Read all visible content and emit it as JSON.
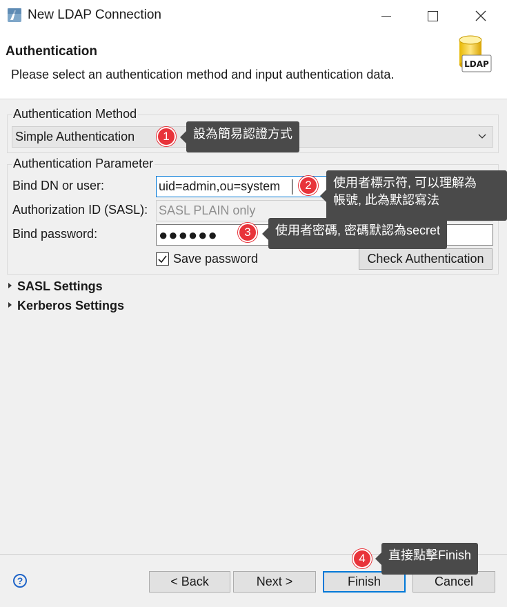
{
  "window": {
    "title": "New LDAP Connection",
    "minimize": "—",
    "maximize": "☐",
    "close": "✕"
  },
  "header": {
    "title": "Authentication",
    "description": "Please select an authentication method and input authentication data.",
    "logo_text": "LDAP"
  },
  "auth_method": {
    "group_label": "Authentication Method",
    "selected": "Simple Authentication"
  },
  "auth_param": {
    "group_label": "Authentication Parameter",
    "bind_dn_label": "Bind DN or user:",
    "bind_dn_value": "uid=admin,ou=system",
    "authz_label": "Authorization ID (SASL):",
    "authz_placeholder": "SASL PLAIN only",
    "password_label": "Bind password:",
    "password_value": "●●●●●●",
    "save_password_label": "Save password",
    "save_password_checked": true,
    "check_auth_label": "Check Authentication"
  },
  "sections": {
    "sasl": "SASL Settings",
    "kerberos": "Kerberos Settings"
  },
  "footer": {
    "help": "?",
    "back": "< Back",
    "next": "Next >",
    "finish": "Finish",
    "cancel": "Cancel"
  },
  "annotations": [
    {
      "number": "1",
      "text": "設為簡易認證方式"
    },
    {
      "number": "2",
      "text_line1": "使用者標示符, 可以理解為",
      "text_line2": "帳號, 此為默認寫法"
    },
    {
      "number": "3",
      "text": "使用者密碼, 密碼默認為secret"
    },
    {
      "number": "4",
      "text": "直接點擊Finish"
    }
  ],
  "colors": {
    "accent": "#0078d7",
    "badge": "#e8333a",
    "callout_bg": "#4a4a4a"
  }
}
